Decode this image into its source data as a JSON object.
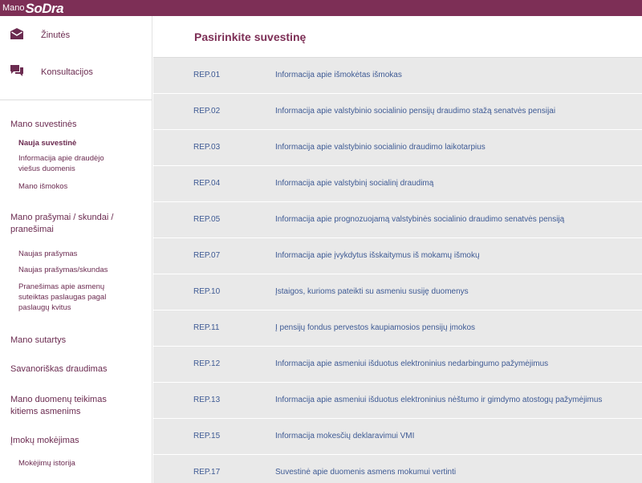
{
  "brand": {
    "prefix": "Mano",
    "name": "SoDra"
  },
  "top_nav": {
    "messages_label": "Žinutės",
    "consultations_label": "Konsultacijos"
  },
  "sidebar": {
    "sections": [
      {
        "title": "Mano suvestinės",
        "items": [
          "Nauja suvestinė",
          "Informacija apie draudėjo viešus duomenis",
          "Mano išmokos"
        ]
      },
      {
        "title": "Mano prašymai / skundai / pranešimai",
        "items": [
          "Naujas prašymas",
          "Naujas prašymas/skundas",
          "Pranešimas apie asmenų suteiktas paslaugas pagal paslaugų kvitus"
        ]
      },
      {
        "title": "Mano sutartys",
        "items": []
      },
      {
        "title": "Savanoriškas draudimas",
        "items": []
      },
      {
        "title": "Mano duomenų teikimas kitiems asmenims",
        "items": []
      },
      {
        "title": "Įmokų mokėjimas",
        "items": [
          "Mokėjimų istorija"
        ]
      }
    ]
  },
  "main": {
    "title": "Pasirinkite suvestinę",
    "reports": [
      {
        "code": "REP.01",
        "desc": "Informacija apie išmokėtas išmokas"
      },
      {
        "code": "REP.02",
        "desc": "Informacija apie valstybinio socialinio pensijų draudimo stažą senatvės pensijai"
      },
      {
        "code": "REP.03",
        "desc": "Informacija apie valstybinio socialinio draudimo laikotarpius"
      },
      {
        "code": "REP.04",
        "desc": "Informacija apie valstybinį socialinį draudimą"
      },
      {
        "code": "REP.05",
        "desc": "Informacija apie prognozuojamą valstybinės socialinio draudimo senatvės pensiją"
      },
      {
        "code": "REP.07",
        "desc": "Informacija apie įvykdytus išskaitymus iš mokamų išmokų"
      },
      {
        "code": "REP.10",
        "desc": "Įstaigos, kurioms pateikti su asmeniu susiję duomenys"
      },
      {
        "code": "REP.11",
        "desc": "Į pensijų fondus pervestos kaupiamosios pensijų įmokos"
      },
      {
        "code": "REP.12",
        "desc": "Informacija apie asmeniui išduotus elektroninius nedarbingumo pažymėjimus"
      },
      {
        "code": "REP.13",
        "desc": "Informacija apie asmeniui išduotus elektroninius nėštumo ir gimdymo atostogų pažymėjimus"
      },
      {
        "code": "REP.15",
        "desc": "Informacija mokesčių deklaravimui VMI"
      },
      {
        "code": "REP.17",
        "desc": "Suvestinė apie duomenis asmens mokumui vertinti"
      }
    ]
  },
  "colors": {
    "brand": "#7d2f56",
    "link": "#3e5a94",
    "sidebar_text": "#6b2b50",
    "row_bg": "#e9e9e9"
  }
}
